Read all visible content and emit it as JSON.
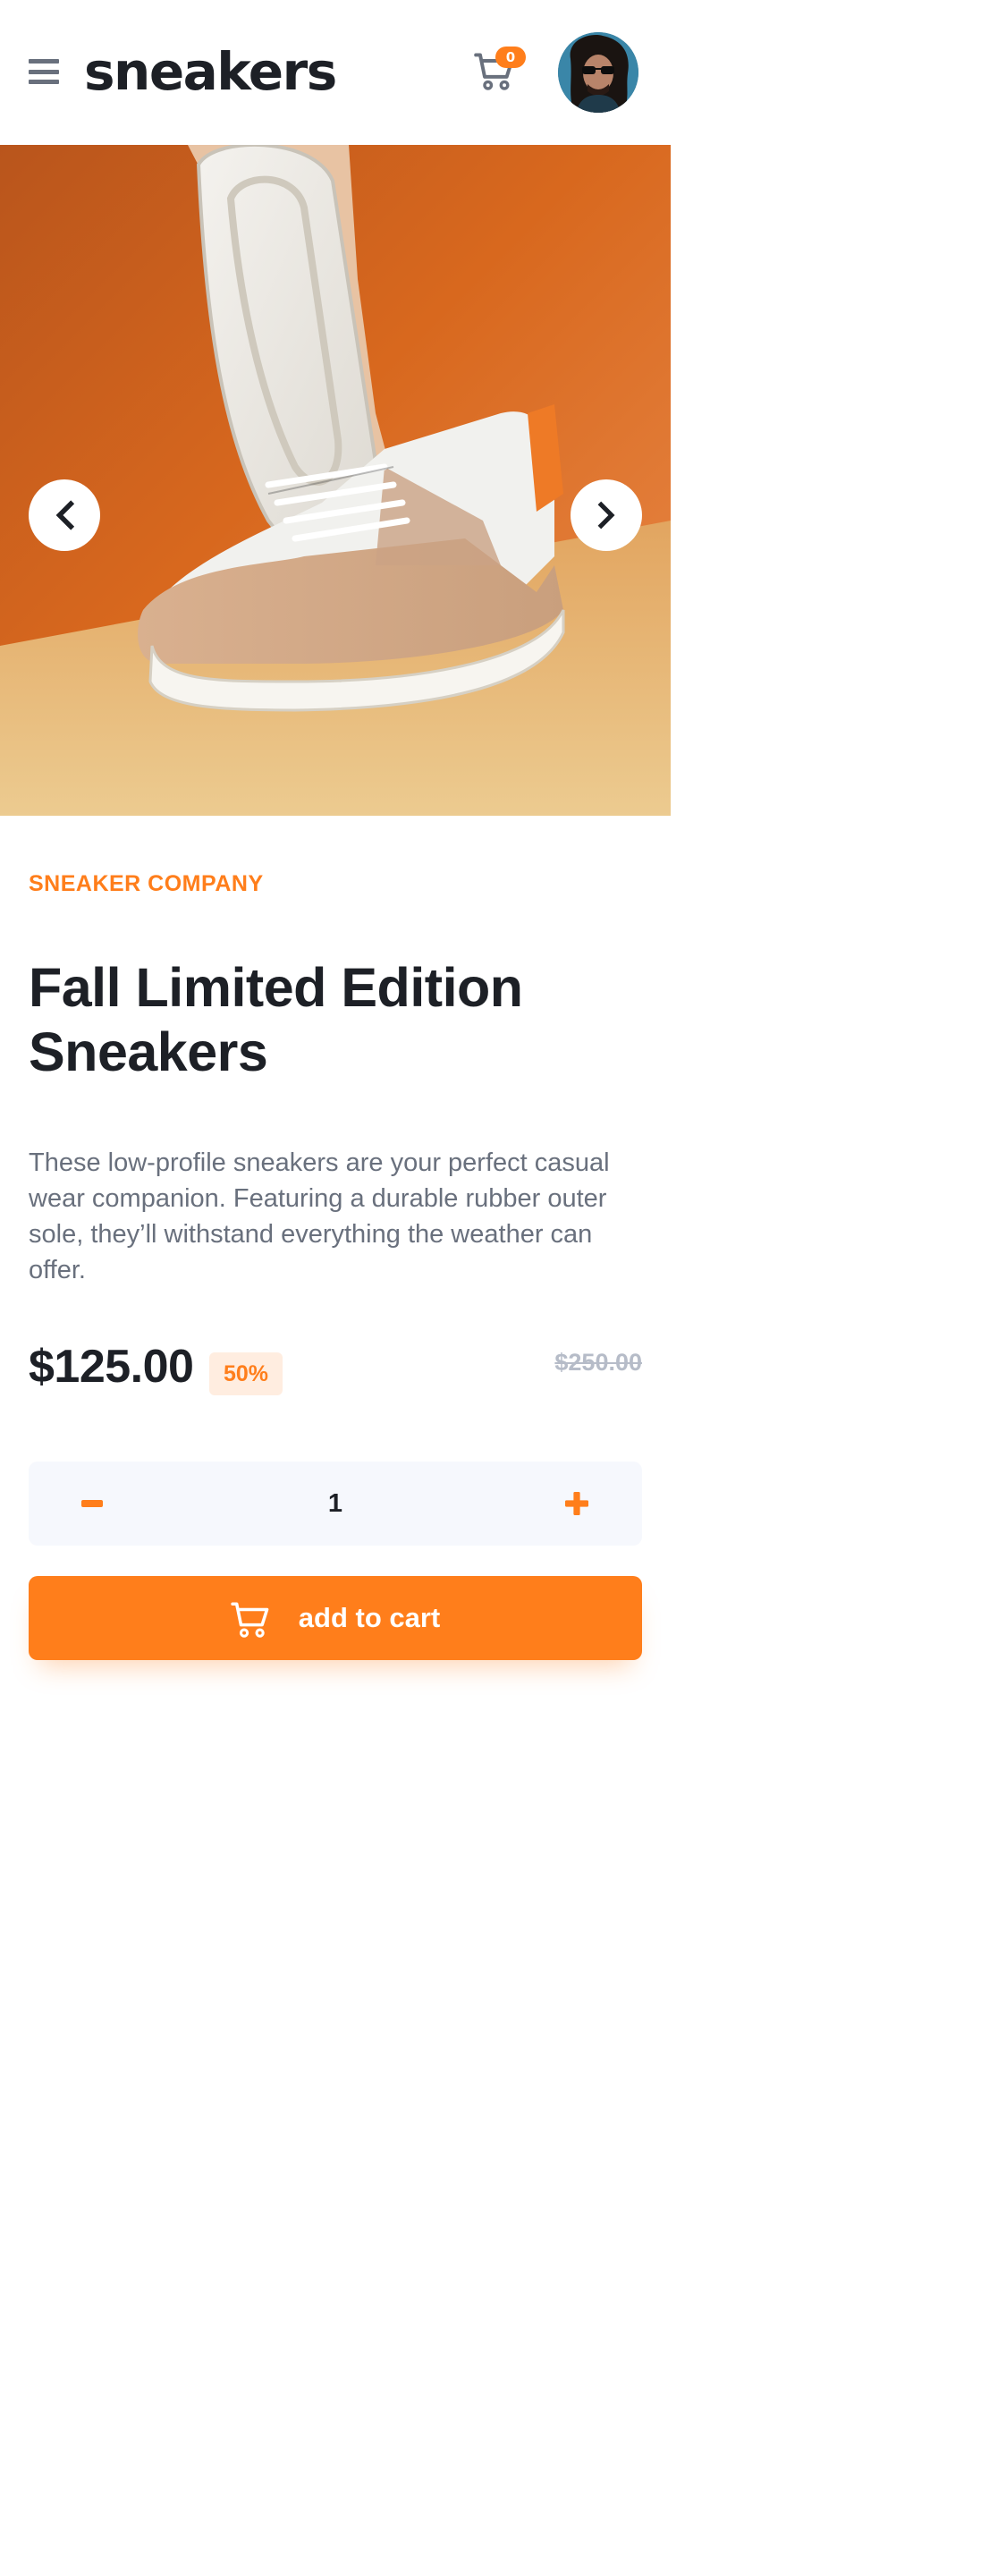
{
  "header": {
    "logo": "sneakers",
    "cart_count": "0",
    "menu_icon": "hamburger-menu-icon",
    "cart_icon": "shopping-cart-icon",
    "avatar": "user-avatar"
  },
  "gallery": {
    "prev_icon": "chevron-left-icon",
    "next_icon": "chevron-right-icon"
  },
  "product": {
    "company": "Sneaker Company",
    "title": "Fall Limited Edition Sneakers",
    "description": "These low-profile sneakers are your perfect casual wear companion. Featuring a durable rubber outer sole, they’ll withstand everything the weather can offer.",
    "price": "$125.00",
    "discount": "50%",
    "original_price": "$250.00"
  },
  "quantity": {
    "value": "1",
    "minus_icon": "minus-icon",
    "plus_icon": "plus-icon"
  },
  "actions": {
    "add_to_cart_label": "add to cart"
  },
  "colors": {
    "accent": "#ff7e1b",
    "accent_pale": "#ffede0",
    "text_dark": "#1d2026",
    "text_gray": "#69707d",
    "text_light": "#b6bcc8",
    "qty_background": "#f6f8fd"
  }
}
